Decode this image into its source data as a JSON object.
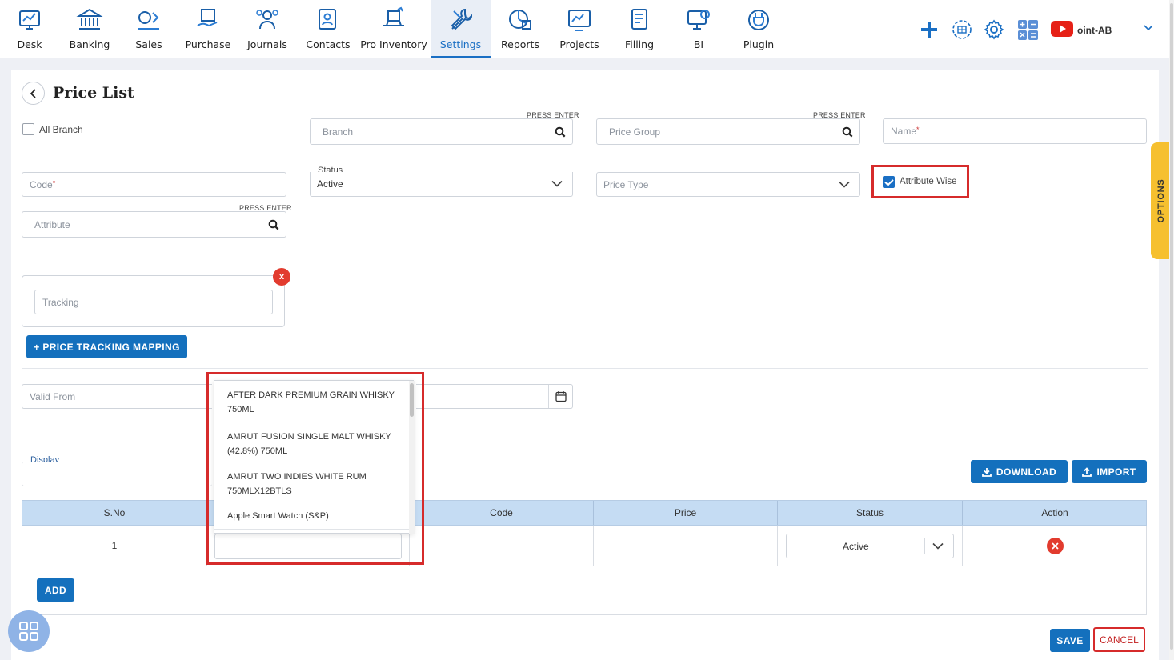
{
  "nav": {
    "items": [
      {
        "label": "Desk",
        "icon": "desk-icon"
      },
      {
        "label": "Banking",
        "icon": "bank-icon"
      },
      {
        "label": "Sales",
        "icon": "sales-icon"
      },
      {
        "label": "Purchase",
        "icon": "purchase-icon"
      },
      {
        "label": "Journals",
        "icon": "journals-icon"
      },
      {
        "label": "Contacts",
        "icon": "contacts-icon"
      },
      {
        "label": "Pro Inventory",
        "icon": "inventory-icon"
      },
      {
        "label": "Settings",
        "icon": "settings-icon"
      },
      {
        "label": "Reports",
        "icon": "reports-icon"
      },
      {
        "label": "Projects",
        "icon": "projects-icon"
      },
      {
        "label": "Filling",
        "icon": "filling-icon"
      },
      {
        "label": "BI",
        "icon": "bi-icon"
      },
      {
        "label": "Plugin",
        "icon": "plugin-icon"
      }
    ],
    "active": "Settings",
    "company": "oint-AB"
  },
  "page": {
    "title": "Price List"
  },
  "form": {
    "all_branch_label": "All Branch",
    "press_enter": "PRESS ENTER",
    "branch_placeholder": "Branch",
    "price_group_placeholder": "Price Group",
    "name_placeholder": "Name",
    "code_placeholder": "Code",
    "status_label": "Status",
    "status_value": "Active",
    "price_type_placeholder": "Price Type",
    "attribute_wise_label": "Attribute Wise",
    "attribute_wise_checked": true,
    "attribute_placeholder": "Attribute",
    "tracking_placeholder": "Tracking",
    "tracking_remove": "x",
    "price_tracking_btn": "+ PRICE TRACKING MAPPING",
    "valid_from_placeholder": "Valid From",
    "display_label": "Display",
    "options_tab": "OPTIONS"
  },
  "toolbar": {
    "download": "DOWNLOAD",
    "import": "IMPORT"
  },
  "table": {
    "columns": [
      "S.No",
      "",
      "Code",
      "Price",
      "Status",
      "Action"
    ],
    "rows": [
      {
        "sno": "1",
        "item": "",
        "code": "",
        "price": "",
        "status": "Active"
      }
    ],
    "add_label": "ADD"
  },
  "dropdown": {
    "items": [
      "AFTER DARK PREMIUM GRAIN WHISKY 750ML",
      "AMRUT FUSION SINGLE MALT WHISKY (42.8%) 750ML",
      "AMRUT TWO INDIES WHITE RUM 750MLX12BTLS",
      "Apple Smart Watch (S&P)"
    ]
  },
  "footer": {
    "save": "SAVE",
    "cancel": "CANCEL"
  },
  "colors": {
    "accent": "#1470bd",
    "highlight_box": "#d62b2b",
    "options_tab": "#f6c02f",
    "table_header": "#c5dcf3"
  }
}
